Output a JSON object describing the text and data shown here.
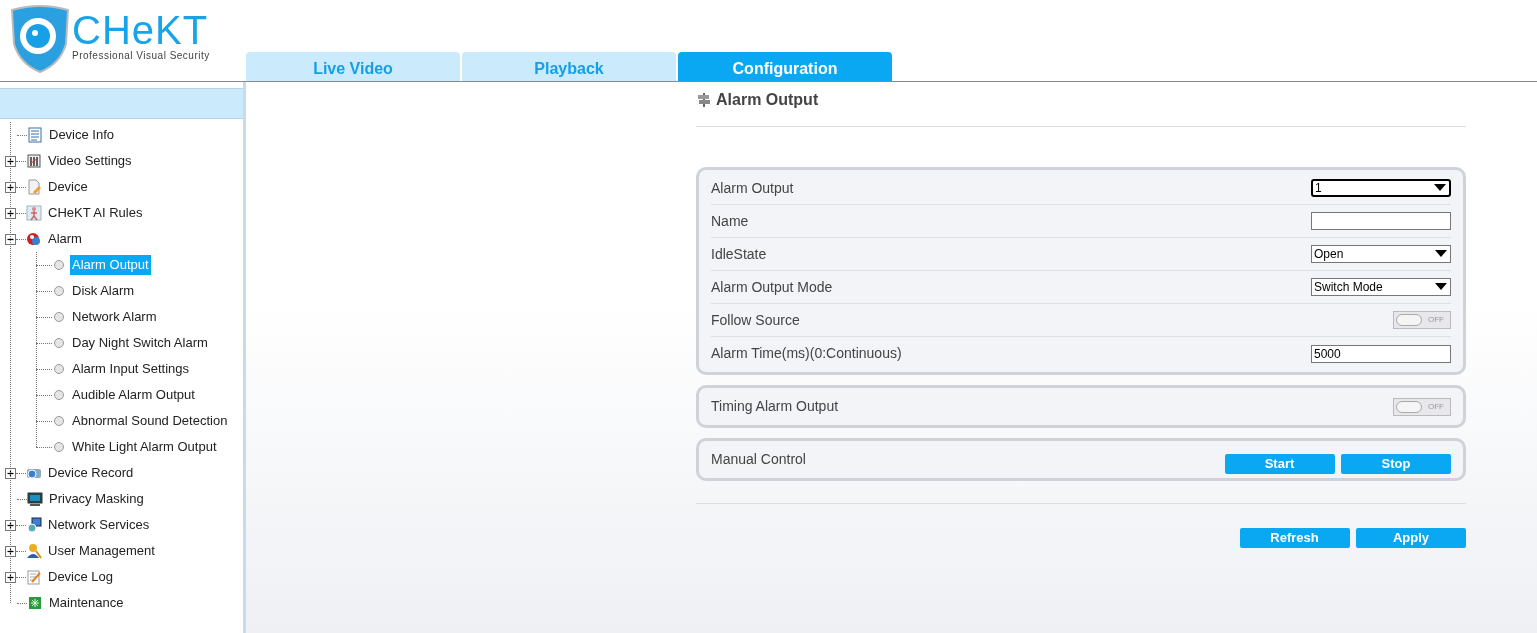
{
  "logo": {
    "name": "CHeKT",
    "tagline": "Professional Visual Security"
  },
  "tabs": [
    {
      "label": "Live Video",
      "selected": false
    },
    {
      "label": "Playback",
      "selected": false
    },
    {
      "label": "Configuration",
      "selected": true
    }
  ],
  "sidebar": {
    "items": [
      {
        "label": "Device Info",
        "kind": "info",
        "selected": false
      },
      {
        "label": "Video Settings",
        "kind": "video",
        "expanded": false,
        "selected": false
      },
      {
        "label": "Device",
        "kind": "device",
        "expanded": false,
        "selected": false
      },
      {
        "label": "CHeKT AI Rules",
        "kind": "person",
        "expanded": false,
        "selected": false
      },
      {
        "label": "Alarm",
        "kind": "alarm",
        "expanded": true,
        "selected": false,
        "children": [
          {
            "label": "Alarm Output",
            "selected": true
          },
          {
            "label": "Disk Alarm",
            "selected": false
          },
          {
            "label": "Network Alarm",
            "selected": false
          },
          {
            "label": "Day Night Switch Alarm",
            "selected": false
          },
          {
            "label": "Alarm Input Settings",
            "selected": false
          },
          {
            "label": "Audible Alarm Output",
            "selected": false
          },
          {
            "label": "Abnormal Sound Detection",
            "selected": false
          },
          {
            "label": "White Light Alarm Output",
            "selected": false
          }
        ]
      },
      {
        "label": "Device Record",
        "kind": "record",
        "expanded": false,
        "selected": false
      },
      {
        "label": "Privacy Masking",
        "kind": "monitor",
        "selected": false
      },
      {
        "label": "Network Services",
        "kind": "network",
        "expanded": false,
        "selected": false
      },
      {
        "label": "User Management",
        "kind": "user",
        "expanded": false,
        "selected": false
      },
      {
        "label": "Device Log",
        "kind": "log",
        "expanded": false,
        "selected": false
      },
      {
        "label": "Maintenance",
        "kind": "maintenance",
        "selected": false
      }
    ]
  },
  "panel": {
    "title": "Alarm Output",
    "groups": [
      {
        "rows": [
          {
            "label": "Alarm Output",
            "kind": "select",
            "value": "1",
            "focused": true
          },
          {
            "label": "Name",
            "kind": "text",
            "value": ""
          },
          {
            "label": "IdleState",
            "kind": "select",
            "value": "Open",
            "focused": false
          },
          {
            "label": "Alarm Output Mode",
            "kind": "select",
            "value": "Switch Mode",
            "focused": false
          },
          {
            "label": "Follow Source",
            "kind": "toggle",
            "on": false,
            "state_text": "OFF"
          },
          {
            "label": "Alarm Time(ms)(0:Continuous)",
            "kind": "text",
            "value": "5000"
          }
        ]
      },
      {
        "rows": [
          {
            "label": "Timing Alarm Output",
            "kind": "toggle",
            "on": false,
            "state_text": "OFF"
          }
        ]
      },
      {
        "rows": [
          {
            "label": "Manual Control",
            "kind": "buttons",
            "buttons": [
              "Start",
              "Stop"
            ]
          }
        ]
      }
    ],
    "footer_buttons": [
      "Refresh",
      "Apply"
    ]
  }
}
